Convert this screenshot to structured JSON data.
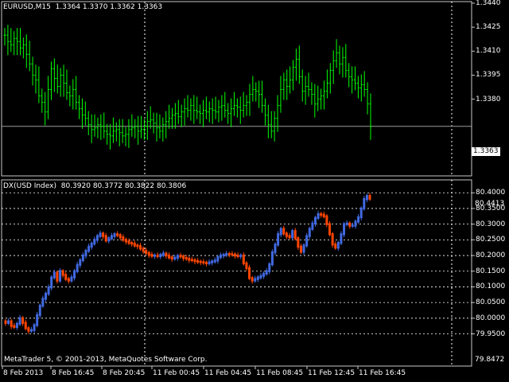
{
  "upper": {
    "symbol_label": "EURUSD,M15",
    "ohlc": "1.3364 1.3370 1.3362 1.3363",
    "current_price_tag": "1.3363",
    "y_ticks": [
      "1.3440",
      "1.3425",
      "1.3410",
      "1.3395",
      "1.3380"
    ],
    "ylim": [
      1.3332,
      1.3441
    ],
    "bar_color": "#00ff00",
    "price_line": 1.3363
  },
  "lower": {
    "symbol_label": "DX(USD Index)",
    "ohlc": "80.3920 80.3772 80.3822 80.3806",
    "top_value": "80.4413",
    "bottom_value": "79.8472",
    "y_ticks": [
      "80.4000",
      "80.3500",
      "80.3000",
      "80.2500",
      "80.2000",
      "80.1500",
      "80.1000",
      "80.0500",
      "80.0000",
      "79.9500"
    ],
    "ylim": [
      79.8472,
      80.4413
    ],
    "up_color": "#4169e1",
    "down_color": "#ff4500"
  },
  "copyright": "MetaTrader 5, © 2001-2013, MetaQuotes Software Corp.",
  "time_labels": [
    "8 Feb 2013",
    "8 Feb 16:45",
    "8 Feb 20:45",
    "11 Feb 00:45",
    "11 Feb 04:45",
    "11 Feb 08:45",
    "11 Feb 12:45",
    "11 Feb 16:45"
  ],
  "chart_data": [
    {
      "type": "bar",
      "title": "EURUSD,M15",
      "y": [
        1.342,
        1.3416,
        1.3414,
        1.3418,
        1.3416,
        1.3412,
        1.3414,
        1.3408,
        1.3402,
        1.3395,
        1.3392,
        1.3382,
        1.3378,
        1.3372,
        1.3386,
        1.3399,
        1.3393,
        1.3388,
        1.3395,
        1.339,
        1.3384,
        1.3382,
        1.3386,
        1.3378,
        1.3374,
        1.337,
        1.3368,
        1.3364,
        1.3361,
        1.3362,
        1.3364,
        1.3363,
        1.336,
        1.3358,
        1.3357,
        1.336,
        1.3361,
        1.3359,
        1.3357,
        1.3358,
        1.3361,
        1.3362,
        1.3363,
        1.336,
        1.3361,
        1.3363,
        1.3366,
        1.3367,
        1.3365,
        1.3362,
        1.336,
        1.3364,
        1.3366,
        1.3368,
        1.337,
        1.3371,
        1.3369,
        1.3372,
        1.3374,
        1.3373,
        1.3376,
        1.3373,
        1.3372,
        1.3371,
        1.3373,
        1.3372,
        1.3374,
        1.3373,
        1.3372,
        1.3375,
        1.3376,
        1.3373,
        1.3371,
        1.3374,
        1.3376,
        1.3375,
        1.3373,
        1.3376,
        1.3378,
        1.3383,
        1.3386,
        1.3385,
        1.3383,
        1.3376,
        1.337,
        1.3364,
        1.336,
        1.3368,
        1.3376,
        1.3386,
        1.3392,
        1.3388,
        1.3392,
        1.34,
        1.3405,
        1.3394,
        1.3385,
        1.3388,
        1.3386,
        1.3383,
        1.3377,
        1.338,
        1.3382,
        1.3385,
        1.339,
        1.3398,
        1.3404,
        1.3409,
        1.3402,
        1.3406,
        1.3398,
        1.3394,
        1.3392,
        1.339,
        1.3387,
        1.3389,
        1.3386,
        1.3377,
        1.3363
      ]
    },
    {
      "type": "bar",
      "title": "DX(USD Index)",
      "y": [
        79.985,
        79.99,
        79.975,
        79.972,
        79.982,
        80.0,
        79.985,
        79.968,
        79.96,
        79.962,
        79.978,
        80.01,
        80.04,
        80.062,
        80.078,
        80.098,
        80.13,
        80.145,
        80.12,
        80.15,
        80.138,
        80.125,
        80.12,
        80.13,
        80.15,
        80.17,
        80.185,
        80.2,
        80.215,
        80.228,
        80.238,
        80.25,
        80.262,
        80.27,
        80.262,
        80.248,
        80.255,
        80.262,
        80.268,
        80.265,
        80.258,
        80.25,
        80.245,
        80.24,
        80.238,
        80.232,
        80.23,
        80.222,
        80.215,
        80.208,
        80.202,
        80.199,
        80.2,
        80.198,
        80.202,
        80.206,
        80.2,
        80.194,
        80.19,
        80.193,
        80.199,
        80.197,
        80.192,
        80.19,
        80.186,
        80.185,
        80.182,
        80.18,
        80.179,
        80.177,
        80.175,
        80.178,
        80.181,
        80.184,
        80.195,
        80.2,
        80.202,
        80.205,
        80.204,
        80.203,
        80.2,
        80.198,
        80.2,
        80.175,
        80.16,
        80.128,
        80.12,
        80.125,
        80.13,
        80.135,
        80.142,
        80.15,
        80.172,
        80.21,
        80.235,
        80.268,
        80.285,
        80.27,
        80.262,
        80.258,
        80.278,
        80.255,
        80.228,
        80.212,
        80.232,
        80.262,
        80.285,
        80.302,
        80.32,
        80.332,
        80.33,
        80.325,
        80.3,
        80.268,
        80.235,
        80.225,
        80.24,
        80.268,
        80.3,
        80.302,
        80.295,
        80.295,
        80.308,
        80.322,
        80.35,
        80.38,
        80.39,
        80.381
      ]
    }
  ]
}
